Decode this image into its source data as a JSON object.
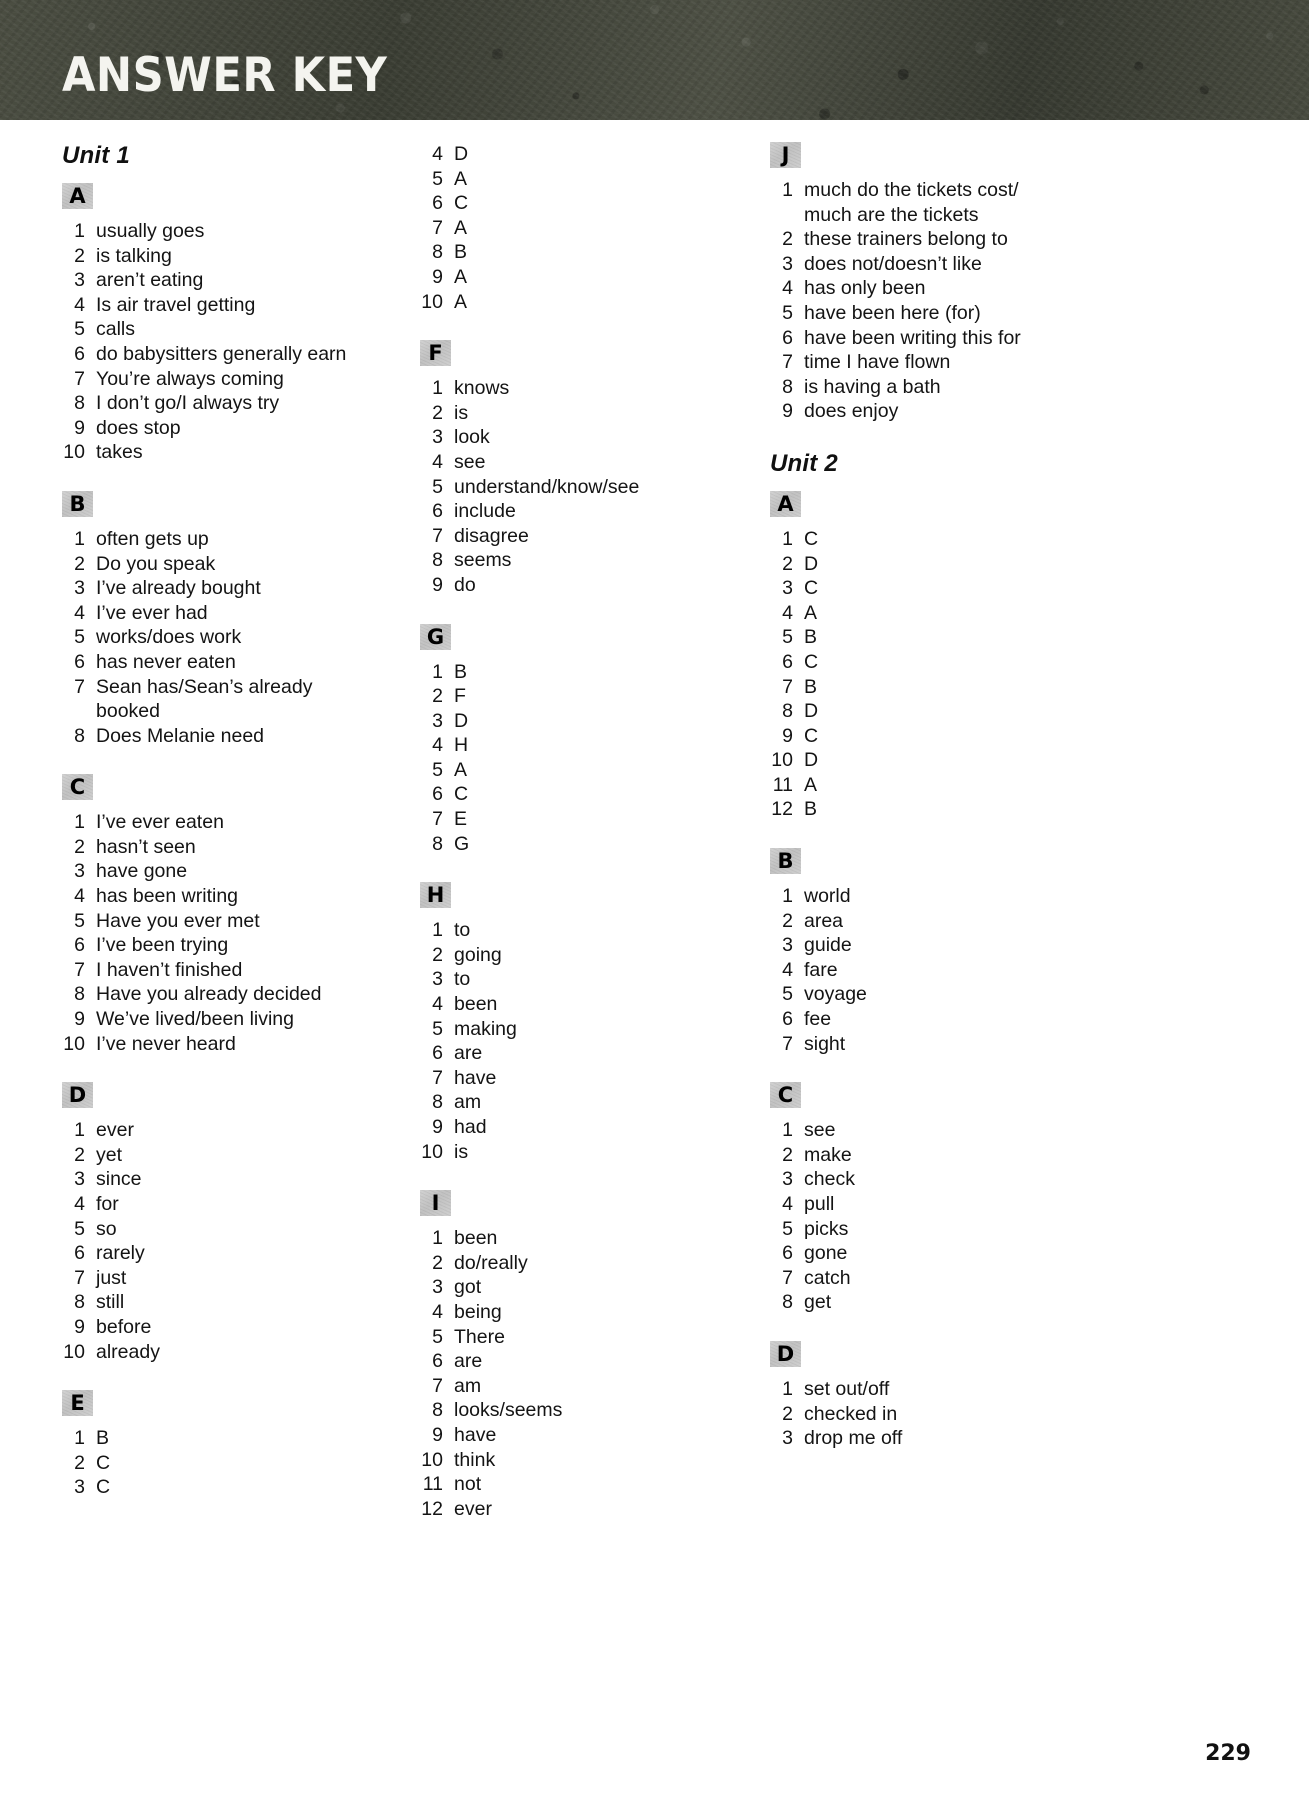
{
  "header": {
    "title": "ANSWER KEY"
  },
  "page_number": "229",
  "columns": [
    {
      "name": "column-1",
      "blocks": [
        {
          "type": "unit",
          "label": "Unit 1"
        },
        {
          "type": "section",
          "letter": "A",
          "style": "words",
          "items": [
            {
              "num": "1",
              "text": "usually goes"
            },
            {
              "num": "2",
              "text": "is talking"
            },
            {
              "num": "3",
              "text": "aren’t eating"
            },
            {
              "num": "4",
              "text": "Is air travel getting"
            },
            {
              "num": "5",
              "text": "calls"
            },
            {
              "num": "6",
              "text": "do babysitters generally earn"
            },
            {
              "num": "7",
              "text": "You’re always coming"
            },
            {
              "num": "8",
              "text": "I don’t go/I always try"
            },
            {
              "num": "9",
              "text": "does stop"
            },
            {
              "num": "10",
              "text": "takes"
            }
          ]
        },
        {
          "type": "section",
          "letter": "B",
          "style": "words",
          "items": [
            {
              "num": "1",
              "text": "often gets up"
            },
            {
              "num": "2",
              "text": "Do you speak"
            },
            {
              "num": "3",
              "text": "I’ve already bought"
            },
            {
              "num": "4",
              "text": "I’ve ever had"
            },
            {
              "num": "5",
              "text": "works/does work"
            },
            {
              "num": "6",
              "text": "has never eaten"
            },
            {
              "num": "7",
              "text": "Sean has/Sean’s already",
              "cont": "booked"
            },
            {
              "num": "8",
              "text": "Does Melanie need"
            }
          ]
        },
        {
          "type": "section",
          "letter": "C",
          "style": "words",
          "items": [
            {
              "num": "1",
              "text": "I’ve ever eaten"
            },
            {
              "num": "2",
              "text": "hasn’t seen"
            },
            {
              "num": "3",
              "text": "have gone"
            },
            {
              "num": "4",
              "text": "has been writing"
            },
            {
              "num": "5",
              "text": "Have you ever met"
            },
            {
              "num": "6",
              "text": "I’ve been trying"
            },
            {
              "num": "7",
              "text": "I haven’t finished"
            },
            {
              "num": "8",
              "text": "Have you already decided"
            },
            {
              "num": "9",
              "text": "We’ve lived/been living"
            },
            {
              "num": "10",
              "text": "I’ve never heard"
            }
          ]
        },
        {
          "type": "section",
          "letter": "D",
          "style": "words",
          "items": [
            {
              "num": "1",
              "text": "ever"
            },
            {
              "num": "2",
              "text": "yet"
            },
            {
              "num": "3",
              "text": "since"
            },
            {
              "num": "4",
              "text": "for"
            },
            {
              "num": "5",
              "text": "so"
            },
            {
              "num": "6",
              "text": "rarely"
            },
            {
              "num": "7",
              "text": "just"
            },
            {
              "num": "8",
              "text": "still"
            },
            {
              "num": "9",
              "text": "before"
            },
            {
              "num": "10",
              "text": "already"
            }
          ]
        },
        {
          "type": "section",
          "letter": "E",
          "style": "letters",
          "items": [
            {
              "num": "1",
              "text": "B"
            },
            {
              "num": "2",
              "text": "C"
            },
            {
              "num": "3",
              "text": "C"
            }
          ]
        }
      ]
    },
    {
      "name": "column-2",
      "blocks": [
        {
          "type": "section",
          "letter": "",
          "style": "letters",
          "continued": true,
          "items": [
            {
              "num": "4",
              "text": "D"
            },
            {
              "num": "5",
              "text": "A"
            },
            {
              "num": "6",
              "text": "C"
            },
            {
              "num": "7",
              "text": "A"
            },
            {
              "num": "8",
              "text": "B"
            },
            {
              "num": "9",
              "text": "A"
            },
            {
              "num": "10",
              "text": "A"
            }
          ]
        },
        {
          "type": "section",
          "letter": "F",
          "style": "words",
          "items": [
            {
              "num": "1",
              "text": "knows"
            },
            {
              "num": "2",
              "text": "is"
            },
            {
              "num": "3",
              "text": "look"
            },
            {
              "num": "4",
              "text": "see"
            },
            {
              "num": "5",
              "text": "understand/know/see"
            },
            {
              "num": "6",
              "text": "include"
            },
            {
              "num": "7",
              "text": "disagree"
            },
            {
              "num": "8",
              "text": "seems"
            },
            {
              "num": "9",
              "text": "do"
            }
          ]
        },
        {
          "type": "section",
          "letter": "G",
          "style": "letters",
          "items": [
            {
              "num": "1",
              "text": "B"
            },
            {
              "num": "2",
              "text": "F"
            },
            {
              "num": "3",
              "text": "D"
            },
            {
              "num": "4",
              "text": "H"
            },
            {
              "num": "5",
              "text": "A"
            },
            {
              "num": "6",
              "text": "C"
            },
            {
              "num": "7",
              "text": "E"
            },
            {
              "num": "8",
              "text": "G"
            }
          ]
        },
        {
          "type": "section",
          "letter": "H",
          "style": "words",
          "items": [
            {
              "num": "1",
              "text": "to"
            },
            {
              "num": "2",
              "text": "going"
            },
            {
              "num": "3",
              "text": "to"
            },
            {
              "num": "4",
              "text": "been"
            },
            {
              "num": "5",
              "text": "making"
            },
            {
              "num": "6",
              "text": "are"
            },
            {
              "num": "7",
              "text": "have"
            },
            {
              "num": "8",
              "text": "am"
            },
            {
              "num": "9",
              "text": "had"
            },
            {
              "num": "10",
              "text": "is"
            }
          ]
        },
        {
          "type": "section",
          "letter": "I",
          "style": "words",
          "items": [
            {
              "num": "1",
              "text": "been"
            },
            {
              "num": "2",
              "text": "do/really"
            },
            {
              "num": "3",
              "text": "got"
            },
            {
              "num": "4",
              "text": "being"
            },
            {
              "num": "5",
              "text": "There"
            },
            {
              "num": "6",
              "text": "are"
            },
            {
              "num": "7",
              "text": "am"
            },
            {
              "num": "8",
              "text": "looks/seems"
            },
            {
              "num": "9",
              "text": "have"
            },
            {
              "num": "10",
              "text": "think"
            },
            {
              "num": "11",
              "text": "not"
            },
            {
              "num": "12",
              "text": "ever"
            }
          ]
        }
      ]
    },
    {
      "name": "column-3",
      "blocks": [
        {
          "type": "section",
          "letter": "J",
          "style": "words",
          "items": [
            {
              "num": "1",
              "text": "much do the tickets cost/",
              "cont": "much are the tickets"
            },
            {
              "num": "2",
              "text": "these trainers belong to"
            },
            {
              "num": "3",
              "text": "does not/doesn’t like"
            },
            {
              "num": "4",
              "text": "has only been"
            },
            {
              "num": "5",
              "text": "have been here (for)"
            },
            {
              "num": "6",
              "text": "have been writing this for"
            },
            {
              "num": "7",
              "text": "time I have flown"
            },
            {
              "num": "8",
              "text": "is having a bath"
            },
            {
              "num": "9",
              "text": "does enjoy"
            }
          ]
        },
        {
          "type": "unit",
          "label": "Unit 2"
        },
        {
          "type": "section",
          "letter": "A",
          "style": "letters",
          "items": [
            {
              "num": "1",
              "text": "C"
            },
            {
              "num": "2",
              "text": "D"
            },
            {
              "num": "3",
              "text": "C"
            },
            {
              "num": "4",
              "text": "A"
            },
            {
              "num": "5",
              "text": "B"
            },
            {
              "num": "6",
              "text": "C"
            },
            {
              "num": "7",
              "text": "B"
            },
            {
              "num": "8",
              "text": "D"
            },
            {
              "num": "9",
              "text": "C"
            },
            {
              "num": "10",
              "text": "D"
            },
            {
              "num": "11",
              "text": "A"
            },
            {
              "num": "12",
              "text": "B"
            }
          ]
        },
        {
          "type": "section",
          "letter": "B",
          "style": "words",
          "items": [
            {
              "num": "1",
              "text": "world"
            },
            {
              "num": "2",
              "text": "area"
            },
            {
              "num": "3",
              "text": "guide"
            },
            {
              "num": "4",
              "text": "fare"
            },
            {
              "num": "5",
              "text": "voyage"
            },
            {
              "num": "6",
              "text": "fee"
            },
            {
              "num": "7",
              "text": "sight"
            }
          ]
        },
        {
          "type": "section",
          "letter": "C",
          "style": "words",
          "items": [
            {
              "num": "1",
              "text": "see"
            },
            {
              "num": "2",
              "text": "make"
            },
            {
              "num": "3",
              "text": "check"
            },
            {
              "num": "4",
              "text": "pull"
            },
            {
              "num": "5",
              "text": "picks"
            },
            {
              "num": "6",
              "text": "gone"
            },
            {
              "num": "7",
              "text": "catch"
            },
            {
              "num": "8",
              "text": "get"
            }
          ]
        },
        {
          "type": "section",
          "letter": "D",
          "style": "words",
          "items": [
            {
              "num": "1",
              "text": "set out/off"
            },
            {
              "num": "2",
              "text": "checked in"
            },
            {
              "num": "3",
              "text": "drop me off"
            }
          ]
        }
      ]
    }
  ]
}
